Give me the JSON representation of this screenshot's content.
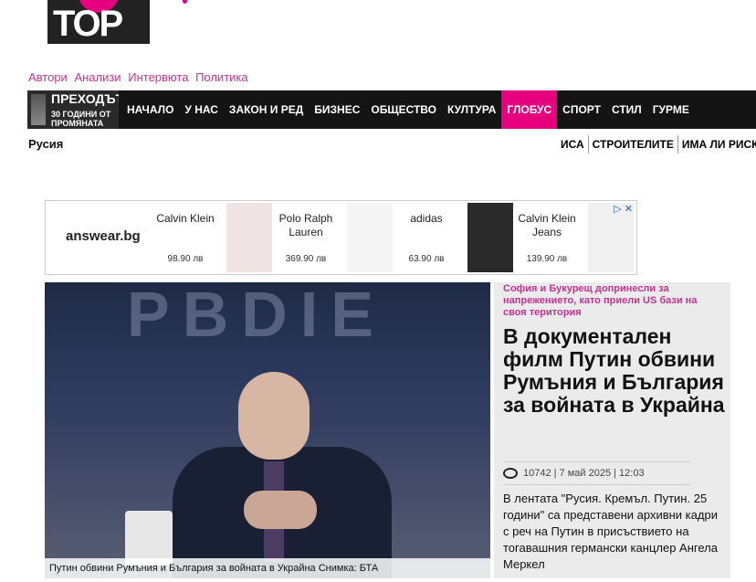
{
  "logo": {
    "text": "ТОР"
  },
  "top_links": [
    "Автори",
    "Анализи",
    "Интервюта",
    "Политика"
  ],
  "brand": {
    "line1": "ПРЕХОДЪТ",
    "line2a": "30 ГОДИНИ ОТ",
    "line2b": "ПРОМЯНАТА"
  },
  "nav": {
    "items": [
      "НАЧАЛО",
      "У НАС",
      "ЗАКОН И РЕД",
      "БИЗНЕС",
      "ОБЩЕСТВО",
      "КУЛТУРА",
      "ГЛОБУС",
      "СПОРТ",
      "СТИЛ",
      "ГУРМЕ"
    ],
    "active": "ГЛОБУС"
  },
  "section_label": "Русия",
  "ticker": [
    "ИСА",
    "СТРОИТЕЛИТЕ",
    "ИМА ЛИ РИСК З"
  ],
  "ad": {
    "logo": "answear.bg",
    "products": [
      {
        "brand": "Calvin Klein",
        "price": "98.90 лв"
      },
      {
        "brand": "Polo Ralph Lauren",
        "price": "369.90 лв"
      },
      {
        "brand": "adidas",
        "price": "63.90 лв"
      },
      {
        "brand": "Calvin Klein Jeans",
        "price": "139.90 лв"
      }
    ]
  },
  "article": {
    "image_caption": "Путин обвини Румъния и България за войната в Украйна Снимка: БТА",
    "kicker": "София и Букурещ допринесли за напрежението, като приели US бази на своя територия",
    "title": "В документален филм Путин обвини Румъния и България за войната в Украйна",
    "views": "10742",
    "date": "7 май 2025",
    "time": "12:03",
    "meta_line": "10742 | 7 май 2025 | 12:03",
    "lead": "В лентата \"Русия. Кремъл. Путин. 25 години\" са представени архивни кадри с реч на Путин в присъствието на тогавашния германски канцлер Ангела Меркел"
  },
  "colors": {
    "accent": "#e6007e",
    "link": "#c5338f",
    "nav_bg": "#141414"
  }
}
